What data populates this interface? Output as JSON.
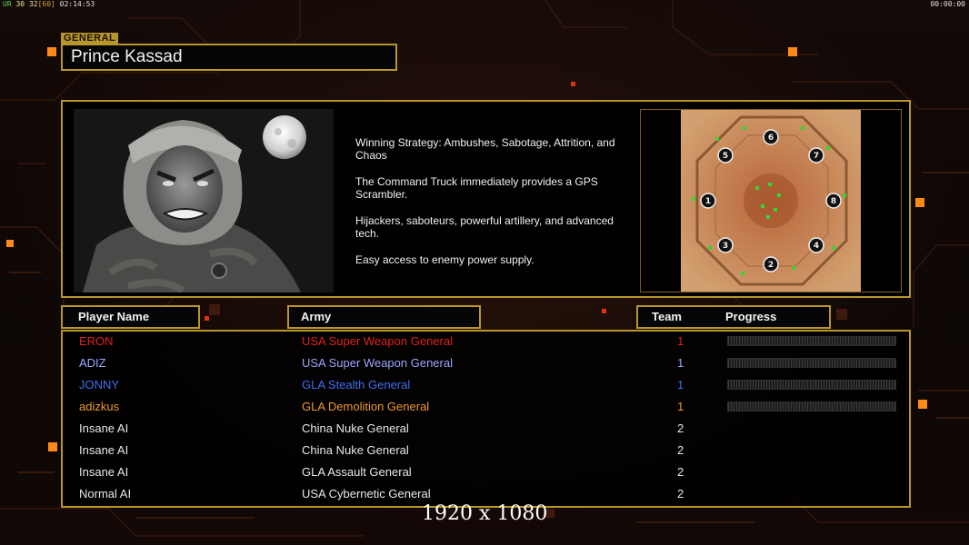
{
  "hud": {
    "fps_a": "UR",
    "fps_b": "30",
    "fps_c": "32",
    "fps_d": "[60]",
    "clock": "02:14:53",
    "timer": "00:00:00"
  },
  "general": {
    "tag": "GENERAL",
    "name": "Prince Kassad"
  },
  "strategy": [
    "Winning Strategy: Ambushes, Sabotage, Attrition, and\n Chaos",
    "The Command Truck immediately provides a GPS\n Scrambler.",
    "Hijackers, saboteurs, powerful artillery, and advanced\n tech.",
    "Easy access to enemy power supply."
  ],
  "map": {
    "start_positions": [
      "1",
      "2",
      "3",
      "4",
      "5",
      "6",
      "7",
      "8"
    ]
  },
  "headers": {
    "player_name": "Player Name",
    "army": "Army",
    "team": "Team",
    "progress": "Progress"
  },
  "players": [
    {
      "name": "ERON",
      "army": "USA Super Weapon General",
      "team": "1",
      "color": "#e02020",
      "team_color": "#e02020",
      "progress": true
    },
    {
      "name": "ADIZ",
      "army": "USA Super Weapon General",
      "team": "1",
      "color": "#9aa6ff",
      "team_color": "#9aa6ff",
      "progress": true
    },
    {
      "name": "JONNY",
      "army": "GLA Stealth General",
      "team": "1",
      "color": "#3f6ef0",
      "team_color": "#3f6ef0",
      "progress": true
    },
    {
      "name": "adizkus",
      "army": "GLA Demolition General",
      "team": "1",
      "color": "#f09a2a",
      "team_color": "#f09a2a",
      "progress": true
    },
    {
      "name": "Insane AI",
      "army": "China Nuke General",
      "team": "2",
      "color": "#e8e8e8",
      "team_color": "#e8e8e8",
      "progress": false
    },
    {
      "name": "Insane AI",
      "army": "China Nuke General",
      "team": "2",
      "color": "#e8e8e8",
      "team_color": "#e8e8e8",
      "progress": false
    },
    {
      "name": "Insane AI",
      "army": "GLA Assault General",
      "team": "2",
      "color": "#e8e8e8",
      "team_color": "#e8e8e8",
      "progress": false
    },
    {
      "name": "Normal AI",
      "army": "USA Cybernetic General",
      "team": "2",
      "color": "#e8e8e8",
      "team_color": "#e8e8e8",
      "progress": false
    }
  ],
  "resolution": "1920 x 1080",
  "colors": {
    "frame_gold": "#b8962a",
    "accent_orange": "#ff8a1a"
  }
}
